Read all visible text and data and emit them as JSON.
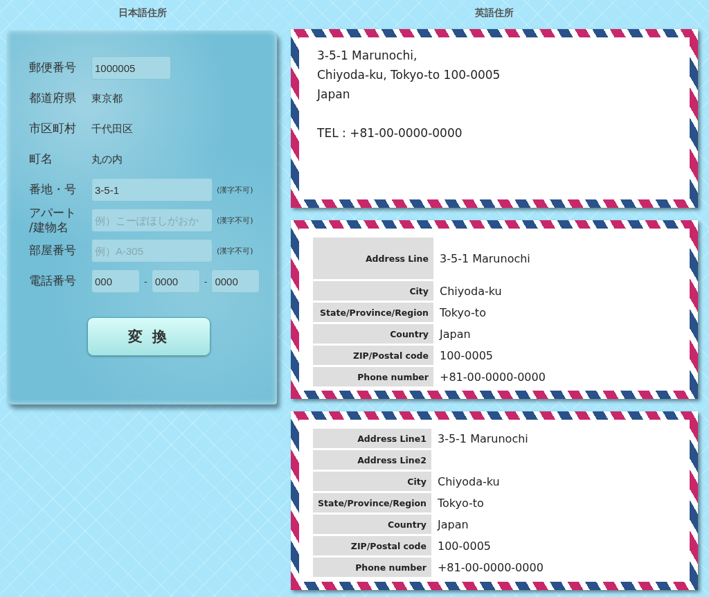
{
  "japanese": {
    "heading": "日本語住所",
    "fields": [
      {
        "kind": "postal",
        "label": "郵便番号",
        "value": "1000005"
      },
      {
        "kind": "text",
        "label": "都道府県",
        "value": "東京都"
      },
      {
        "kind": "text",
        "label": "市区町村",
        "value": "千代田区"
      },
      {
        "kind": "text",
        "label": "町名",
        "value": "丸の内"
      },
      {
        "kind": "input",
        "label": "番地・号",
        "value": "3-5-1",
        "note": "(漢字不可)"
      },
      {
        "kind": "input",
        "label": "アパート\n/建物名",
        "placeholder": "例）こーぽほしがおか",
        "note": "(漢字不可)"
      },
      {
        "kind": "input",
        "label": "部屋番号",
        "placeholder": "例）A-305",
        "note": "(漢字不可)"
      },
      {
        "kind": "phone",
        "label": "電話番号",
        "values": [
          "000",
          "0000",
          "0000"
        ],
        "separators": [
          "-",
          "-"
        ]
      }
    ],
    "button": "変 換"
  },
  "english": {
    "heading": "英語住所",
    "envelopes": [
      {
        "kind": "letter",
        "paragraphs": [
          [
            "3-5-1 Marunochi,",
            "Chiyoda-ku, Tokyo-to 100-0005",
            "Japan"
          ],
          [
            "TEL : +81-00-0000-0000"
          ]
        ]
      },
      {
        "kind": "table",
        "rows": [
          {
            "label": "Address Line",
            "value": "3-5-1 Marunochi"
          },
          {
            "label": "City",
            "value": "Chiyoda-ku"
          },
          {
            "label": "State/Province/Region",
            "value": "Tokyo-to"
          },
          {
            "label": "Country",
            "value": "Japan"
          },
          {
            "label": "ZIP/Postal code",
            "value": "100-0005"
          },
          {
            "label": "Phone number",
            "value": "+81-00-0000-0000"
          }
        ]
      },
      {
        "kind": "table",
        "rows": [
          {
            "label": "Address Line1",
            "value": "3-5-1 Marunochi"
          },
          {
            "label": "Address Line2"
          },
          {
            "label": "City",
            "value": "Chiyoda-ku"
          },
          {
            "label": "State/Province/Region",
            "value": "Tokyo-to"
          },
          {
            "label": "Country",
            "value": "Japan"
          },
          {
            "label": "ZIP/Postal code",
            "value": "100-0005"
          },
          {
            "label": "Phone number",
            "value": "+81-00-0000-0000"
          }
        ]
      }
    ]
  }
}
